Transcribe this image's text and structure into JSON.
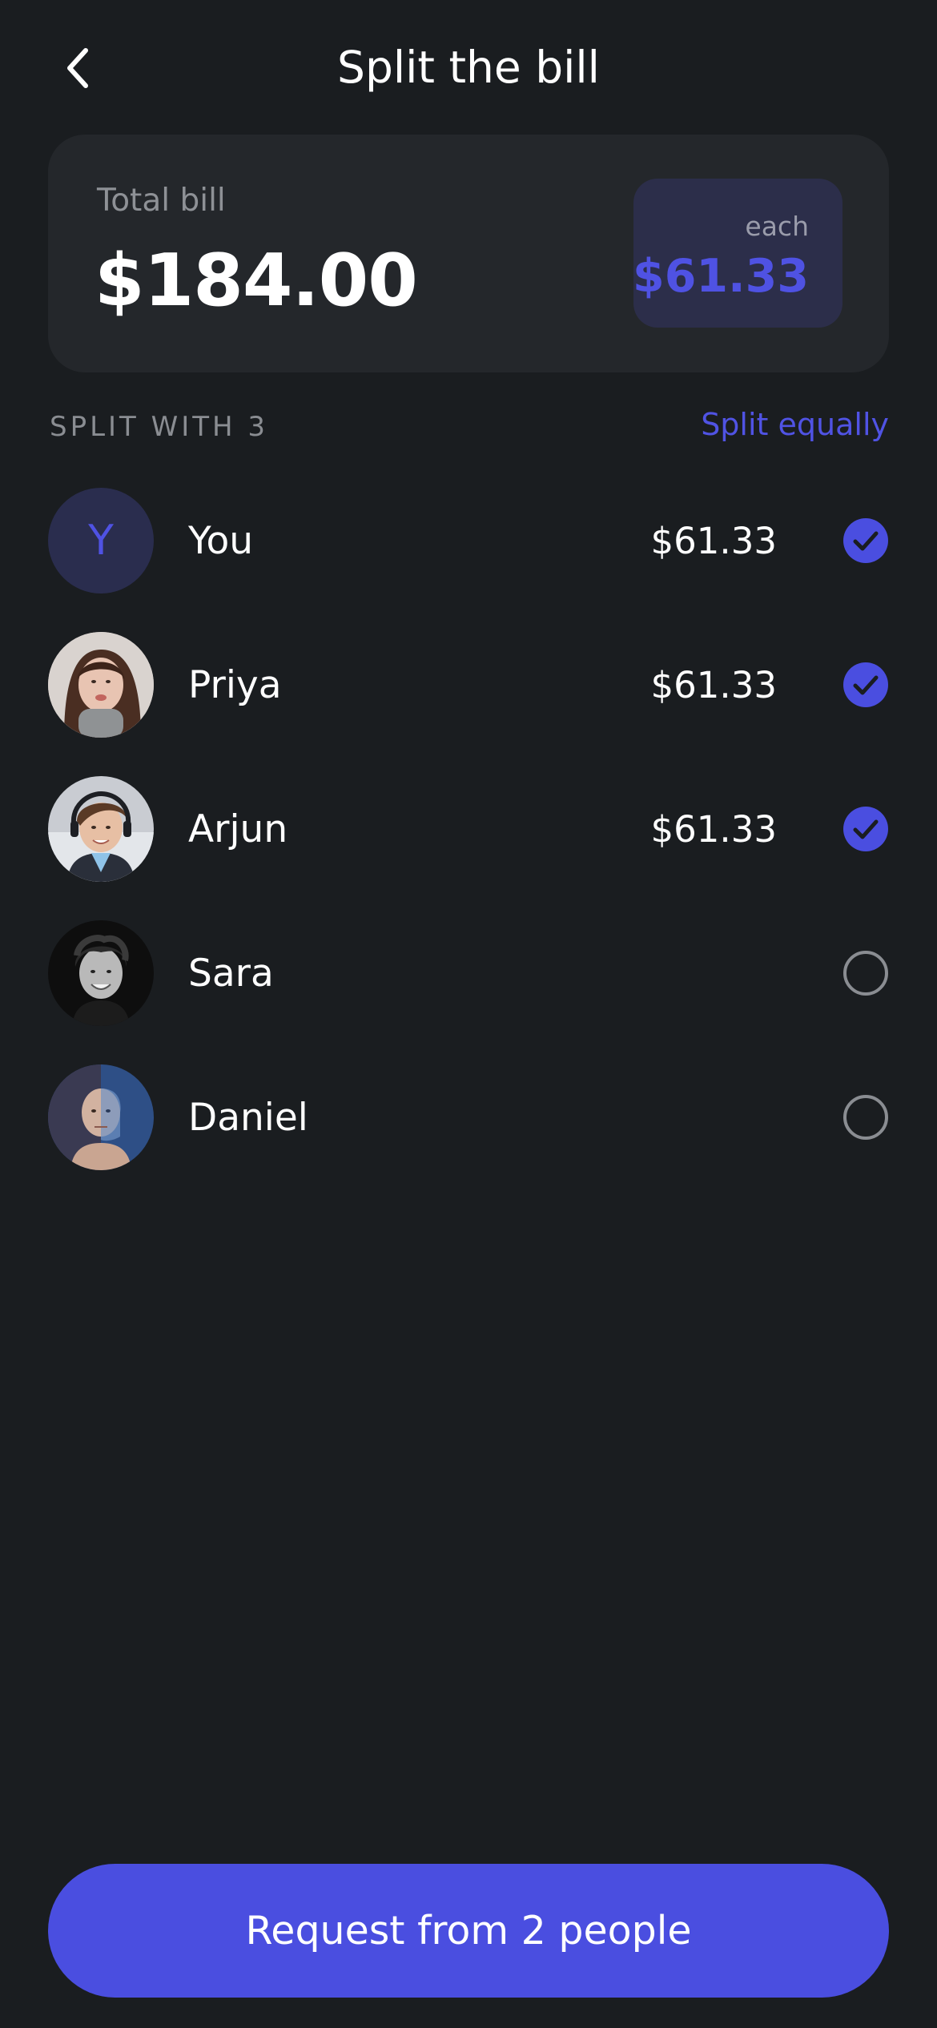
{
  "header": {
    "title": "Split the bill",
    "back_icon": "chevron-left-icon"
  },
  "total": {
    "label": "Total bill",
    "amount": "$184.00",
    "each_label": "each",
    "each_amount": "$61.33"
  },
  "section": {
    "label": "SPLIT WITH 3",
    "action": "Split equally"
  },
  "participants": [
    {
      "name": "You",
      "initial": "Y",
      "share": "$61.33",
      "selected": true
    },
    {
      "name": "Priya",
      "share": "$61.33",
      "selected": true
    },
    {
      "name": "Arjun",
      "share": "$61.33",
      "selected": true
    },
    {
      "name": "Sara",
      "share": "",
      "selected": false
    },
    {
      "name": "Daniel",
      "share": "",
      "selected": false
    }
  ],
  "footer": {
    "button_label": "Request from 2 people"
  },
  "colors": {
    "background": "#1a1d20",
    "card": "#24272b",
    "accent": "#4a4ee0",
    "muted_text": "#8a8d92"
  }
}
